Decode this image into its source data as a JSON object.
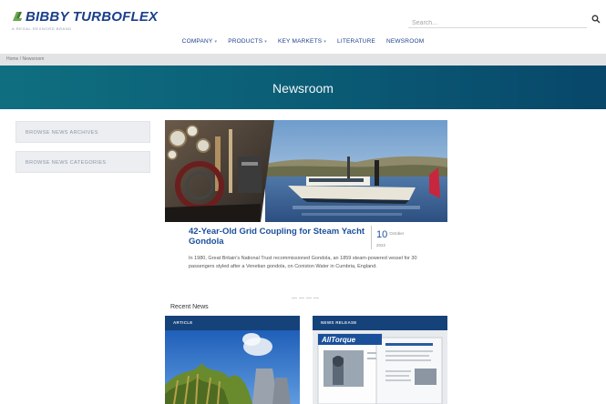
{
  "brand": {
    "name": "BIBBY TURBOFLEX",
    "tagline": "A REGAL REXNORD BRAND"
  },
  "search": {
    "placeholder": "Search..."
  },
  "nav": {
    "items": [
      {
        "label": "COMPANY",
        "has_dropdown": true
      },
      {
        "label": "PRODUCTS",
        "has_dropdown": true
      },
      {
        "label": "KEY MARKETS",
        "has_dropdown": true
      },
      {
        "label": "LITERATURE",
        "has_dropdown": false
      },
      {
        "label": "NEWSROOM",
        "has_dropdown": false
      }
    ]
  },
  "breadcrumb": {
    "home": "Home",
    "separator": "/",
    "current": "Newsroom"
  },
  "banner": {
    "title": "Newsroom"
  },
  "sidebar": {
    "items": [
      {
        "label": "BROWSE NEWS ARCHIVES"
      },
      {
        "label": "BROWSE NEWS CATEGORIES"
      }
    ]
  },
  "featured": {
    "title": "42-Year-Old Grid Coupling for Steam Yacht Gondola",
    "date_day": "10",
    "date_month": "October",
    "date_year": "2022",
    "description": "In 1980, Great Britain's National Trust recommissioned Gondola, an 1859 steam-powered vessel for 30 passengers styled after a Venetian gondola, on Coniston Water in Cumbria, England."
  },
  "recent": {
    "title": "Recent News",
    "cards": [
      {
        "category": "ARTICLE"
      },
      {
        "category": "NEWS RELEASE",
        "image_text": "AllTorque"
      }
    ]
  },
  "colors": {
    "brand_blue": "#1c3f8c",
    "banner_teal": "#0b5f77",
    "card_header": "#16427a",
    "link_blue": "#1c4f9c"
  }
}
